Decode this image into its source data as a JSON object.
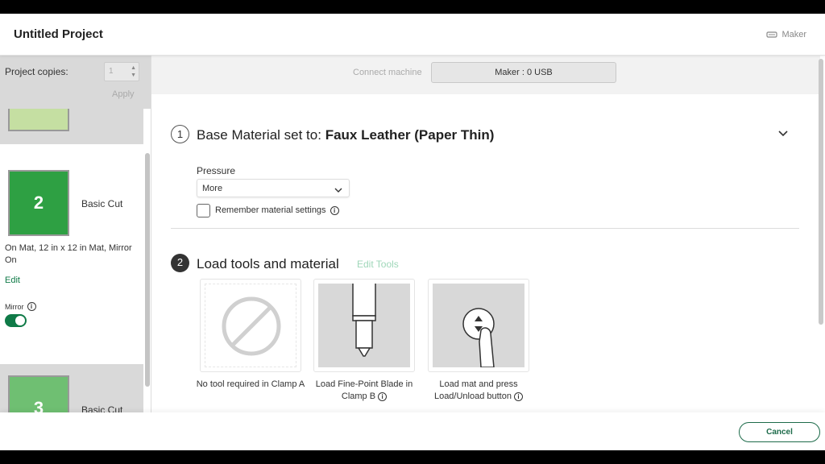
{
  "header": {
    "title": "Untitled Project",
    "machine_label": "Maker",
    "machine_icon": "machine-icon"
  },
  "sidebar": {
    "copies_label": "Project copies:",
    "copies_value": "1",
    "apply_label": "Apply",
    "mats": [
      {
        "number": "2",
        "name": "Basic Cut",
        "color": "#2ea043"
      },
      {
        "number": "3",
        "name": "Basic Cut",
        "color": "#6fbf72"
      }
    ],
    "mat_info": "On Mat, 12 in x 12 in Mat, Mirror On",
    "edit_label": "Edit",
    "mirror_label": "Mirror",
    "mirror_on": true
  },
  "connect": {
    "label": "Connect machine",
    "button": "Maker : 0 USB"
  },
  "step1": {
    "number": "1",
    "title": "Base Material set to:",
    "material": "Faux Leather (Paper Thin)",
    "pressure_label": "Pressure",
    "pressure_value": "More",
    "remember_label": "Remember material settings"
  },
  "step2": {
    "number": "2",
    "title": "Load tools and material",
    "edit_tools": "Edit Tools",
    "tools": [
      {
        "caption": "No tool required in Clamp A",
        "icon": "no-tool-icon"
      },
      {
        "caption": "Load Fine-Point Blade in Clamp B",
        "icon": "fine-point-blade-icon"
      },
      {
        "caption": "Load mat and press Load/Unload button",
        "icon": "load-unload-button-icon"
      }
    ]
  },
  "footer": {
    "cancel_label": "Cancel"
  },
  "colors": {
    "accent": "#0f7a47",
    "cancel": "#1d6b4a",
    "edit_tools": "#9fd7b9"
  }
}
